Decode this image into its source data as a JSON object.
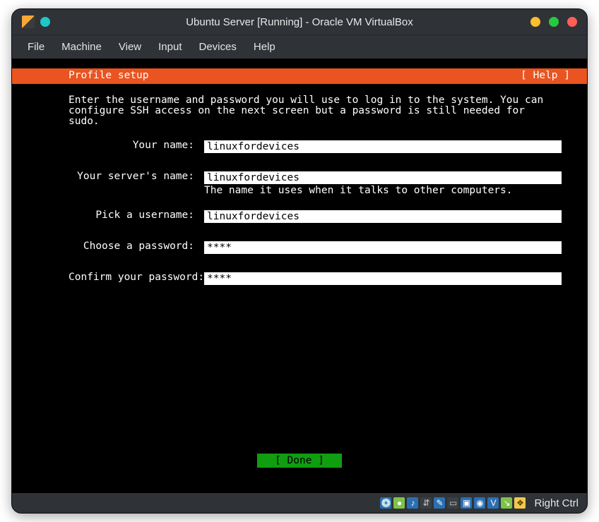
{
  "window": {
    "title": "Ubuntu Server [Running] - Oracle VM VirtualBox",
    "traffic": {
      "close": "#ff5f56",
      "min": "#27c93f",
      "max": "#ffbd2e"
    }
  },
  "menu": {
    "items": [
      "File",
      "Machine",
      "View",
      "Input",
      "Devices",
      "Help"
    ]
  },
  "installer": {
    "header_title": "Profile setup",
    "help_label": "[ Help ]",
    "prompt_lines": [
      "Enter the username and password you will use to log in to the system. You can",
      "configure SSH access on the next screen but a password is still needed for",
      "sudo."
    ],
    "fields": {
      "name": {
        "label": "Your name:",
        "value": "linuxfordevices"
      },
      "server": {
        "label": "Your server's name:",
        "value": "linuxfordevices",
        "hint": "The name it uses when it talks to other computers."
      },
      "username": {
        "label": "Pick a username:",
        "value": "linuxfordevices"
      },
      "password": {
        "label": "Choose a password:",
        "value": "****"
      },
      "confirm": {
        "label": "Confirm your password:",
        "value": "****"
      }
    },
    "done_label": "[ Done       ]"
  },
  "status": {
    "icons": [
      {
        "name": "hdd-icon",
        "glyph": "💿",
        "bg": "#2b6fb3",
        "fg": "#fff"
      },
      {
        "name": "optical-icon",
        "glyph": "●",
        "bg": "#7fc24a",
        "fg": "#fff"
      },
      {
        "name": "audio-icon",
        "glyph": "♪",
        "bg": "#2b6fb3",
        "fg": "#fff"
      },
      {
        "name": "usb-icon",
        "glyph": "⇵",
        "bg": "#3b3f44",
        "fg": "#c9c9c9"
      },
      {
        "name": "shared-folder-icon",
        "glyph": "✎",
        "bg": "#2b6fb3",
        "fg": "#fff"
      },
      {
        "name": "display-icon",
        "glyph": "▭",
        "bg": "#3b3f44",
        "fg": "#c9c9c9"
      },
      {
        "name": "recording-icon",
        "glyph": "▣",
        "bg": "#2b6fb3",
        "fg": "#fff"
      },
      {
        "name": "camera-icon",
        "glyph": "◉",
        "bg": "#2b6fb3",
        "fg": "#fff"
      },
      {
        "name": "network-icon",
        "glyph": "V",
        "bg": "#2b6fb3",
        "fg": "#fff"
      },
      {
        "name": "mouse-integration-icon",
        "glyph": "↘",
        "bg": "#7fc24a",
        "fg": "#fff"
      },
      {
        "name": "clipboard-icon",
        "glyph": "❖",
        "bg": "#f2c84b",
        "fg": "#5a4100"
      }
    ],
    "host_key": "Right Ctrl"
  }
}
